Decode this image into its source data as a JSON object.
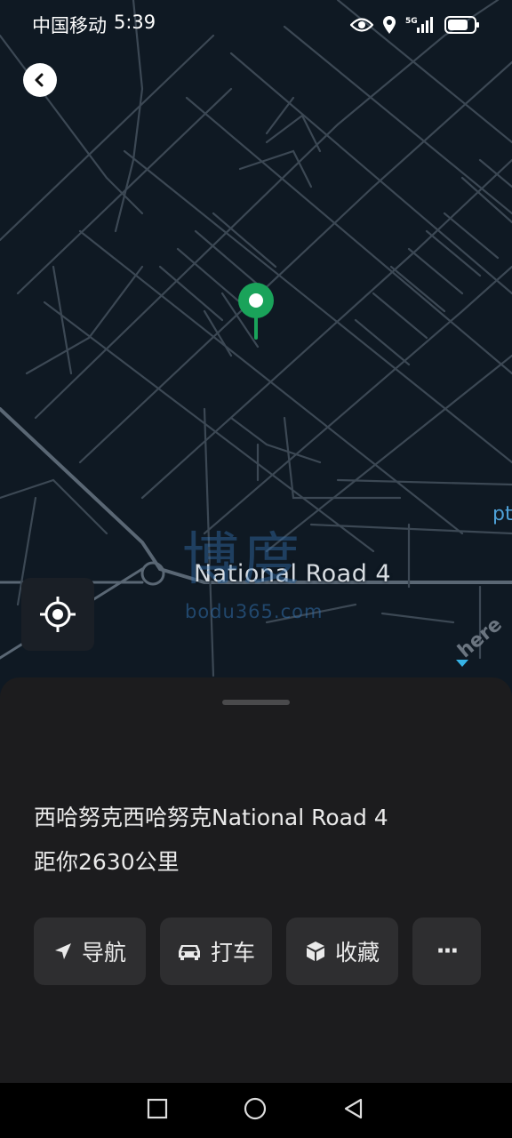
{
  "status_bar": {
    "carrier": "中国移动",
    "time": "5:39",
    "network": "5G",
    "icons": [
      "eye-icon",
      "location-icon",
      "signal-icon",
      "battery-icon"
    ]
  },
  "map": {
    "road_label": "National Road 4",
    "edge_label": "pt",
    "watermark_text": "博度",
    "watermark_url": "bodu365.com",
    "provider_logo": "here",
    "pin_color": "#1aa35a"
  },
  "place": {
    "name": "西哈努克西哈努克National Road 4",
    "distance": "距你2630公里"
  },
  "actions": [
    {
      "label": "导航",
      "icon": "navigate-arrow-icon"
    },
    {
      "label": "打车",
      "icon": "taxi-icon"
    },
    {
      "label": "收藏",
      "icon": "cube-icon"
    },
    {
      "label": "···",
      "icon": "more-icon"
    }
  ],
  "colors": {
    "map_bg": "#0f1923",
    "road": "#44515e",
    "sheet_bg": "#1c1c1e",
    "button_bg": "#2e2e30"
  }
}
